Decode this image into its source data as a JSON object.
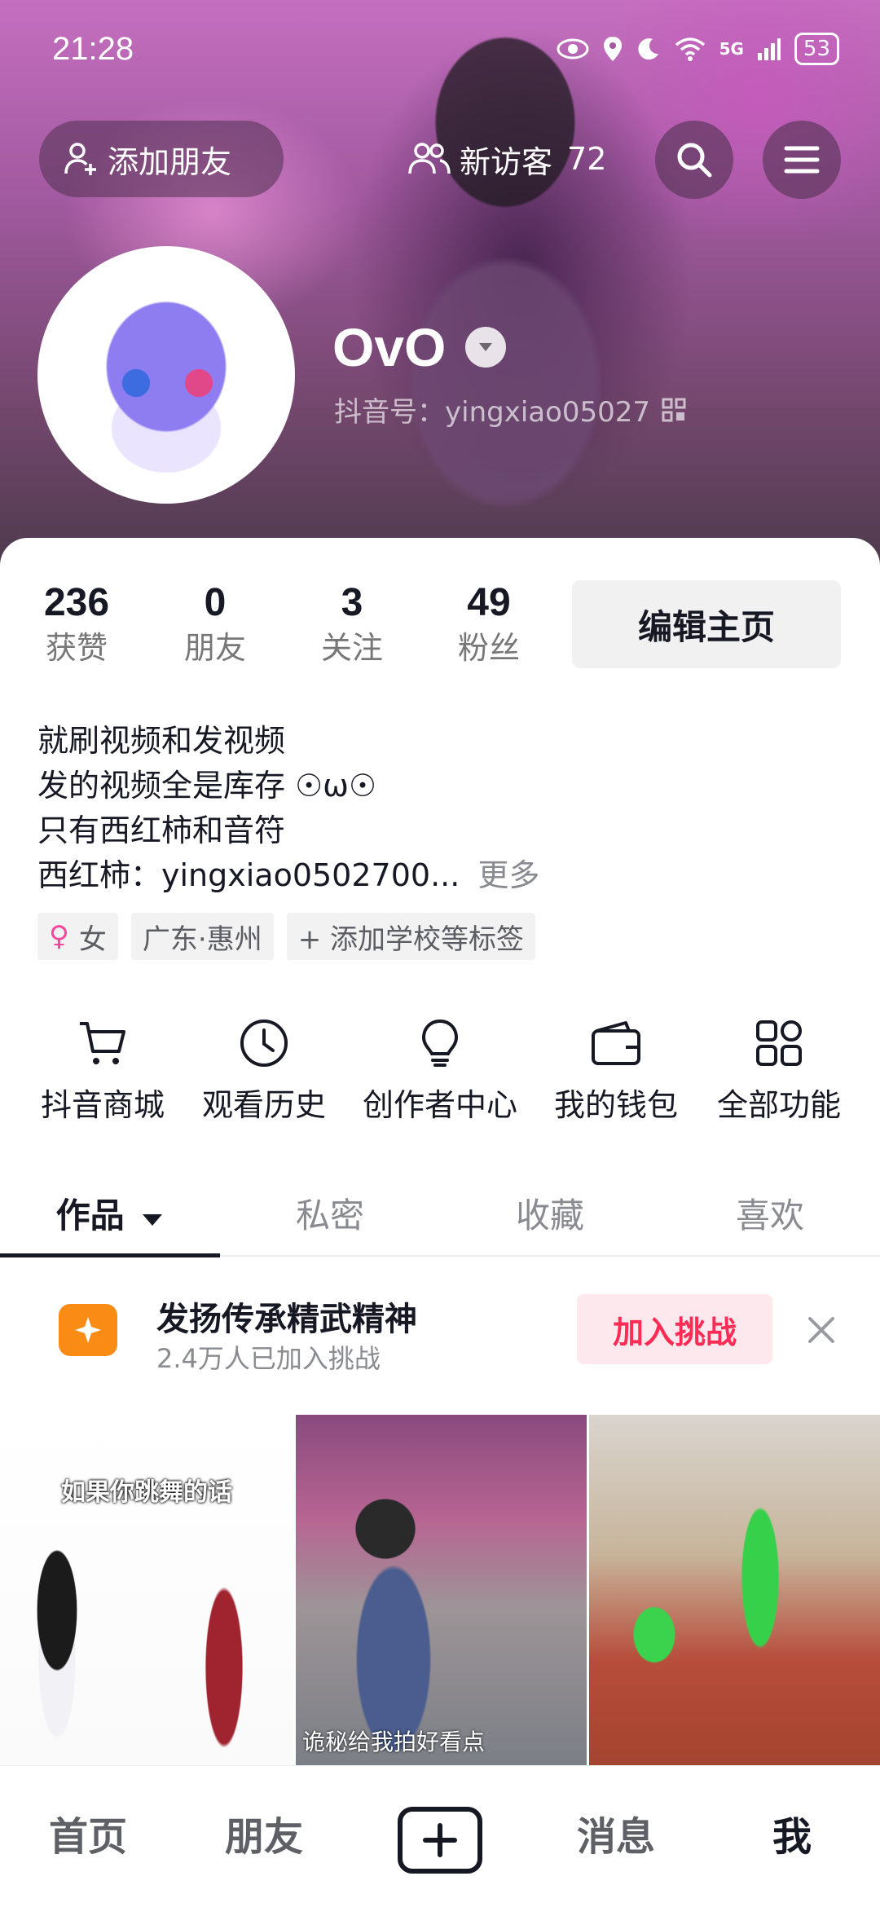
{
  "status": {
    "time": "21:28",
    "network": "5G",
    "battery": "53"
  },
  "header": {
    "add_friend": "添加朋友",
    "visitors_label": "新访客",
    "visitors_count": "72"
  },
  "profile": {
    "nickname": "OvO",
    "douyin_id": "抖音号：yingxiao05027"
  },
  "stats": [
    {
      "num": "236",
      "label": "获赞"
    },
    {
      "num": "0",
      "label": "朋友"
    },
    {
      "num": "3",
      "label": "关注"
    },
    {
      "num": "49",
      "label": "粉丝"
    }
  ],
  "edit_button": "编辑主页",
  "bio": {
    "lines": [
      "就刷视频和发视频",
      "发的视频全是库存 ☉ω☉",
      "只有西红柿和音符",
      "西红柿：yingxiao0502700..."
    ],
    "more": "更多"
  },
  "tags": {
    "gender_symbol": "♀",
    "gender": "女",
    "location": "广东·惠州",
    "add_tag": "+ 添加学校等标签"
  },
  "tools": [
    {
      "label": "抖音商城",
      "icon": "cart-icon"
    },
    {
      "label": "观看历史",
      "icon": "clock-icon"
    },
    {
      "label": "创作者中心",
      "icon": "bulb-icon"
    },
    {
      "label": "我的钱包",
      "icon": "wallet-icon"
    },
    {
      "label": "全部功能",
      "icon": "apps-icon"
    }
  ],
  "tabs": [
    {
      "label": "作品"
    },
    {
      "label": "私密"
    },
    {
      "label": "收藏"
    },
    {
      "label": "喜欢"
    }
  ],
  "challenge": {
    "title": "发扬传承精武精神",
    "subtitle": "2.4万人已加入挑战",
    "join": "加入挑战"
  },
  "videos": {
    "v1_caption": "如果你跳舞的话",
    "v2_caption": "诡秘给我拍好看点"
  },
  "bottom_nav": {
    "home": "首页",
    "friends": "朋友",
    "messages": "消息",
    "me": "我"
  },
  "colors": {
    "accent": "#fe2c55",
    "challenge_icon": "#fa8c16",
    "text": "#161823"
  }
}
